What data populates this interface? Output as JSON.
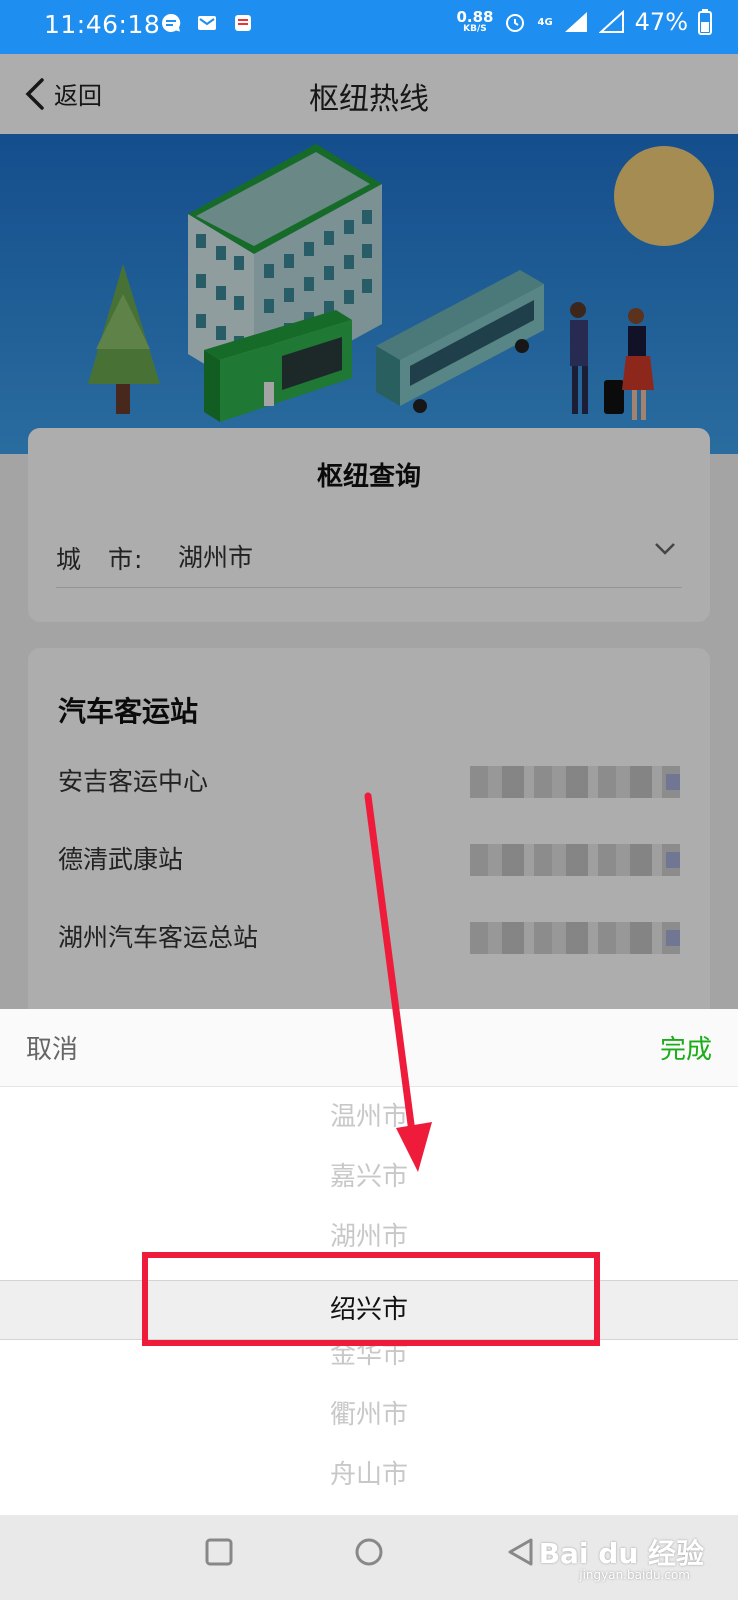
{
  "status_bar": {
    "time": "11:46:18",
    "speed_value": "0.88",
    "speed_unit": "KB/S",
    "network": "4G",
    "battery": "47%"
  },
  "header": {
    "back_label": "返回",
    "title": "枢纽热线"
  },
  "query": {
    "title": "枢纽查询",
    "city_label": "城　市:",
    "city_value": "湖州市"
  },
  "stations": {
    "heading": "汽车客运站",
    "items": [
      {
        "name": "安吉客运中心"
      },
      {
        "name": "德清武康站"
      },
      {
        "name": "湖州汽车客运总站"
      }
    ]
  },
  "picker": {
    "cancel_label": "取消",
    "done_label": "完成",
    "options": [
      "温州市",
      "嘉兴市",
      "湖州市",
      "绍兴市",
      "金华市",
      "衢州市",
      "舟山市"
    ],
    "selected_index": 3
  },
  "watermark": {
    "brand": "Bai du 经验",
    "url": "jingyan.baidu.com"
  },
  "colors": {
    "accent": "#1e8ef0",
    "done": "#1aad19",
    "annotation": "#ee1c3a"
  }
}
